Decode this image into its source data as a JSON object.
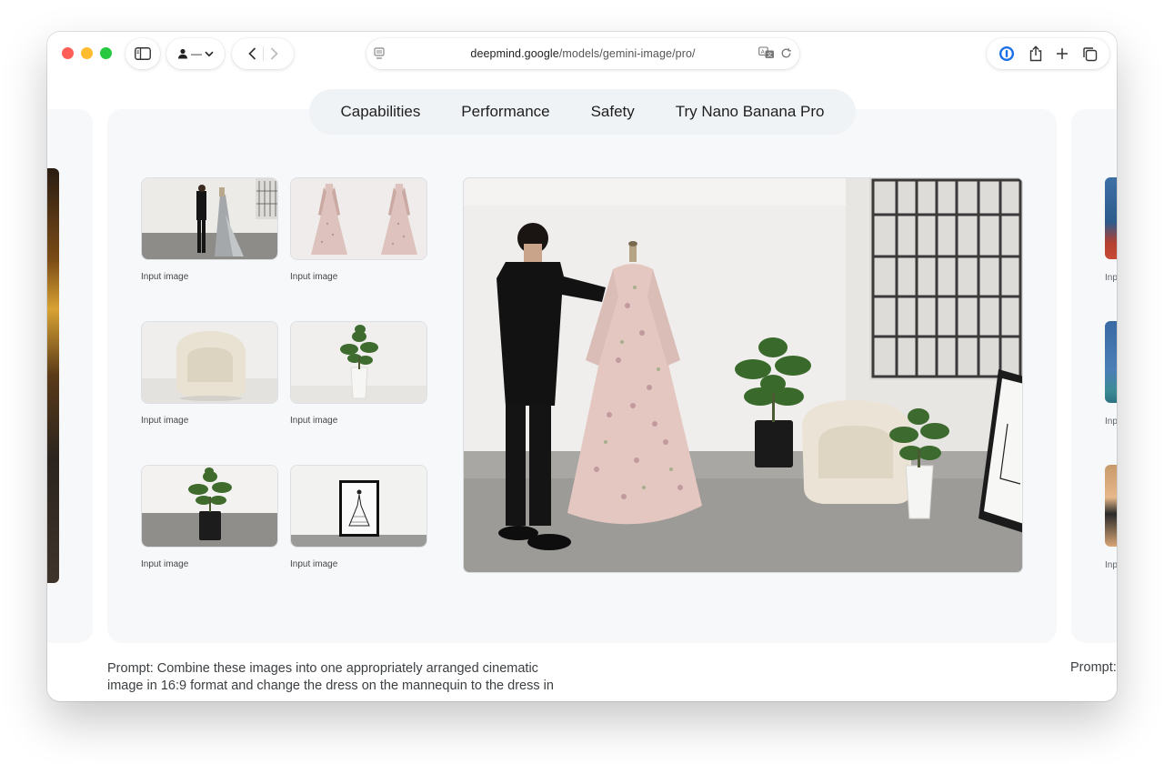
{
  "browser": {
    "url_domain": "deepmind.google",
    "url_path": "/models/gemini-image/pro/",
    "profile_label": "—",
    "icons": [
      "sidebar-icon",
      "person-icon",
      "chevron-down-icon",
      "back-icon",
      "forward-icon",
      "page-icon",
      "translate-icon",
      "reload-icon",
      "password-manager-icon",
      "share-icon",
      "new-tab-icon",
      "tabs-overview-icon"
    ]
  },
  "tabs": [
    {
      "label": "Capabilities"
    },
    {
      "label": "Performance"
    },
    {
      "label": "Safety"
    },
    {
      "label": "Try Nano Banana Pro"
    }
  ],
  "inputs": [
    {
      "label": "Input image",
      "subject": "man beside mannequin in studio"
    },
    {
      "label": "Input image",
      "subject": "pink embroidered gown front and back"
    },
    {
      "label": "Input image",
      "subject": "cream boucle armchair"
    },
    {
      "label": "Input image",
      "subject": "fiddle leaf fig in white vase"
    },
    {
      "label": "Input image",
      "subject": "fiddle leaf fig in black pot"
    },
    {
      "label": "Input image",
      "subject": "framed fashion sketch"
    }
  ],
  "prompt": {
    "text": "Prompt: Combine these images into one appropriately arranged cinematic image in 16:9 format and change the dress on the mannequin to the dress in",
    "next_text": "Prompt:"
  },
  "side_right": {
    "labels": [
      "Inp",
      "Inp",
      "Inp"
    ]
  },
  "colors": {
    "panel_bg": "#f6f8fa",
    "tabs_bg": "#f0f3f6",
    "text_dark": "#1f1f1f",
    "text_muted": "#444746"
  }
}
